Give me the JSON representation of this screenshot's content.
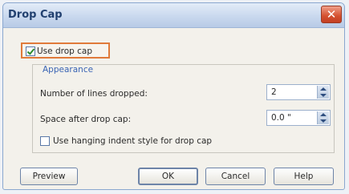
{
  "dialog": {
    "title": "Drop Cap",
    "close_glyph": "✕",
    "use_drop_cap": {
      "label": "Use drop cap",
      "checked": true
    },
    "appearance": {
      "group_title": "Appearance",
      "lines_dropped": {
        "label": "Number of lines dropped:",
        "value": "2"
      },
      "space_after": {
        "label": "Space after drop cap:",
        "value": "0.0 \""
      },
      "hanging_indent": {
        "label": "Use hanging indent style for drop cap",
        "checked": false
      }
    },
    "buttons": {
      "preview": "Preview",
      "ok": "OK",
      "cancel": "Cancel",
      "help": "Help"
    }
  },
  "colors": {
    "highlight": "#e07a3a",
    "title": "#21406f",
    "group_title": "#3a64b4"
  }
}
